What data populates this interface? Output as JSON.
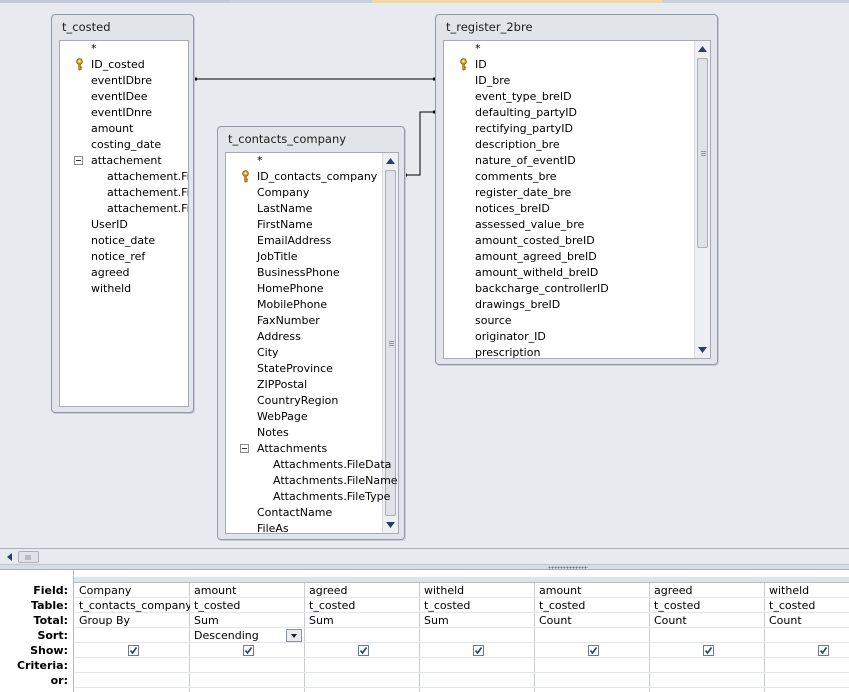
{
  "tables": {
    "t_costed": {
      "title": "t_costed",
      "fields": [
        {
          "label": "*",
          "indent": 0
        },
        {
          "label": "ID_costed",
          "indent": 0,
          "key": true
        },
        {
          "label": "eventIDbre",
          "indent": 0
        },
        {
          "label": "eventIDee",
          "indent": 0
        },
        {
          "label": "eventIDnre",
          "indent": 0
        },
        {
          "label": "amount",
          "indent": 0
        },
        {
          "label": "costing_date",
          "indent": 0
        },
        {
          "label": "attachement",
          "indent": 0,
          "expander": true
        },
        {
          "label": "attachement.FileData",
          "indent": 1
        },
        {
          "label": "attachement.FileName",
          "indent": 1
        },
        {
          "label": "attachement.FileType",
          "indent": 1
        },
        {
          "label": "UserID",
          "indent": 0
        },
        {
          "label": "notice_date",
          "indent": 0
        },
        {
          "label": "notice_ref",
          "indent": 0
        },
        {
          "label": "agreed",
          "indent": 0
        },
        {
          "label": "witheld",
          "indent": 0
        }
      ]
    },
    "t_contacts_company": {
      "title": "t_contacts_company",
      "fields": [
        {
          "label": "*",
          "indent": 0
        },
        {
          "label": "ID_contacts_company",
          "indent": 0,
          "key": true
        },
        {
          "label": "Company",
          "indent": 0
        },
        {
          "label": "LastName",
          "indent": 0
        },
        {
          "label": "FirstName",
          "indent": 0
        },
        {
          "label": "EmailAddress",
          "indent": 0
        },
        {
          "label": "JobTitle",
          "indent": 0
        },
        {
          "label": "BusinessPhone",
          "indent": 0
        },
        {
          "label": "HomePhone",
          "indent": 0
        },
        {
          "label": "MobilePhone",
          "indent": 0
        },
        {
          "label": "FaxNumber",
          "indent": 0
        },
        {
          "label": "Address",
          "indent": 0
        },
        {
          "label": "City",
          "indent": 0
        },
        {
          "label": "StateProvince",
          "indent": 0
        },
        {
          "label": "ZIPPostal",
          "indent": 0
        },
        {
          "label": "CountryRegion",
          "indent": 0
        },
        {
          "label": "WebPage",
          "indent": 0
        },
        {
          "label": "Notes",
          "indent": 0
        },
        {
          "label": "Attachments",
          "indent": 0,
          "expander": true
        },
        {
          "label": "Attachments.FileData",
          "indent": 1
        },
        {
          "label": "Attachments.FileName",
          "indent": 1
        },
        {
          "label": "Attachments.FileType",
          "indent": 1
        },
        {
          "label": "ContactName",
          "indent": 0
        },
        {
          "label": "FileAs",
          "indent": 0
        }
      ]
    },
    "t_register_2bre": {
      "title": "t_register_2bre",
      "fields": [
        {
          "label": "*",
          "indent": 0
        },
        {
          "label": "ID",
          "indent": 0,
          "key": true
        },
        {
          "label": "ID_bre",
          "indent": 0
        },
        {
          "label": "event_type_breID",
          "indent": 0
        },
        {
          "label": "defaulting_partyID",
          "indent": 0
        },
        {
          "label": "rectifying_partyID",
          "indent": 0
        },
        {
          "label": "description_bre",
          "indent": 0
        },
        {
          "label": "nature_of_eventID",
          "indent": 0
        },
        {
          "label": "comments_bre",
          "indent": 0
        },
        {
          "label": "register_date_bre",
          "indent": 0
        },
        {
          "label": "notices_breID",
          "indent": 0
        },
        {
          "label": "assessed_value_bre",
          "indent": 0
        },
        {
          "label": "amount_costed_breID",
          "indent": 0
        },
        {
          "label": "amount_agreed_breID",
          "indent": 0
        },
        {
          "label": "amount_witheld_breID",
          "indent": 0
        },
        {
          "label": "backcharge_controllerID",
          "indent": 0
        },
        {
          "label": "drawings_breID",
          "indent": 0
        },
        {
          "label": "source",
          "indent": 0
        },
        {
          "label": "originator_ID",
          "indent": 0
        },
        {
          "label": "prescription",
          "indent": 0
        }
      ]
    }
  },
  "grid": {
    "row_labels": {
      "field": "Field:",
      "table": "Table:",
      "total": "Total:",
      "sort": "Sort:",
      "show": "Show:",
      "criteria": "Criteria:",
      "or": "or:"
    },
    "columns": [
      {
        "field": "Company",
        "table": "t_contacts_company",
        "total": "Group By",
        "sort": "",
        "show": true
      },
      {
        "field": "amount",
        "table": "t_costed",
        "total": "Sum",
        "sort": "Descending",
        "show": true
      },
      {
        "field": "agreed",
        "table": "t_costed",
        "total": "Sum",
        "sort": "",
        "show": true
      },
      {
        "field": "witheld",
        "table": "t_costed",
        "total": "Sum",
        "sort": "",
        "show": true
      },
      {
        "field": "amount",
        "table": "t_costed",
        "total": "Count",
        "sort": "",
        "show": true
      },
      {
        "field": "agreed",
        "table": "t_costed",
        "total": "Count",
        "sort": "",
        "show": true
      },
      {
        "field": "witheld",
        "table": "t_costed",
        "total": "Count",
        "sort": "",
        "show": true
      }
    ]
  },
  "colors": {
    "canvas": "#e7eaee",
    "window_border": "#8f99a8",
    "join_line": "#000000"
  }
}
